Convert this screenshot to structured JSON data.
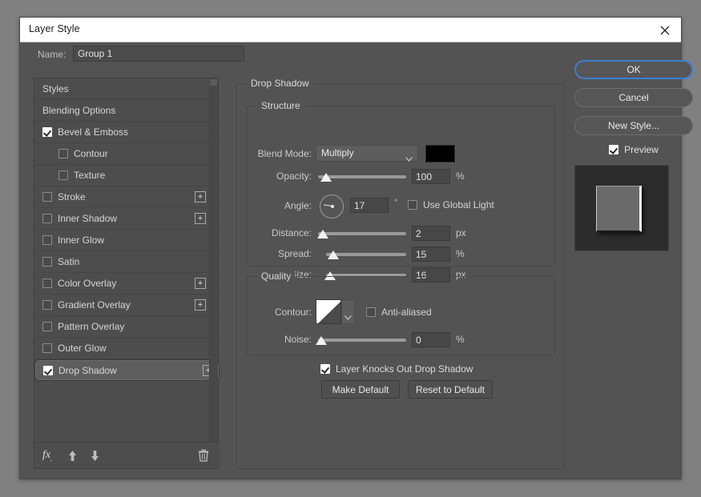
{
  "window": {
    "title": "Layer Style",
    "close_icon": "close-icon"
  },
  "name_field": {
    "label": "Name:",
    "value": "Group 1"
  },
  "styles_list": {
    "items": [
      {
        "label": "Styles",
        "type": "plain",
        "checkbox": null,
        "selected": false,
        "plus": false,
        "indent": false
      },
      {
        "label": "Blending Options",
        "type": "plain",
        "checkbox": null,
        "selected": false,
        "plus": false,
        "indent": false
      },
      {
        "label": "Bevel & Emboss",
        "type": "effect",
        "checkbox": true,
        "selected": false,
        "plus": false,
        "indent": false
      },
      {
        "label": "Contour",
        "type": "effect",
        "checkbox": false,
        "selected": false,
        "plus": false,
        "indent": true
      },
      {
        "label": "Texture",
        "type": "effect",
        "checkbox": false,
        "selected": false,
        "plus": false,
        "indent": true
      },
      {
        "label": "Stroke",
        "type": "effect",
        "checkbox": false,
        "selected": false,
        "plus": true,
        "indent": false
      },
      {
        "label": "Inner Shadow",
        "type": "effect",
        "checkbox": false,
        "selected": false,
        "plus": true,
        "indent": false
      },
      {
        "label": "Inner Glow",
        "type": "effect",
        "checkbox": false,
        "selected": false,
        "plus": false,
        "indent": false
      },
      {
        "label": "Satin",
        "type": "effect",
        "checkbox": false,
        "selected": false,
        "plus": false,
        "indent": false
      },
      {
        "label": "Color Overlay",
        "type": "effect",
        "checkbox": false,
        "selected": false,
        "plus": true,
        "indent": false
      },
      {
        "label": "Gradient Overlay",
        "type": "effect",
        "checkbox": false,
        "selected": false,
        "plus": true,
        "indent": false
      },
      {
        "label": "Pattern Overlay",
        "type": "effect",
        "checkbox": false,
        "selected": false,
        "plus": false,
        "indent": false
      },
      {
        "label": "Outer Glow",
        "type": "effect",
        "checkbox": false,
        "selected": false,
        "plus": false,
        "indent": false
      },
      {
        "label": "Drop Shadow",
        "type": "effect",
        "checkbox": true,
        "selected": true,
        "plus": true,
        "indent": false
      }
    ],
    "footer": {
      "fx_icon": "fx-icon",
      "up_icon": "arrow-up-icon",
      "down_icon": "arrow-down-icon",
      "trash_icon": "trash-icon"
    }
  },
  "settings": {
    "section_title": "Drop Shadow",
    "structure": {
      "legend": "Structure",
      "blend_mode_label": "Blend Mode:",
      "blend_mode_value": "Multiply",
      "shadow_color": "#000000",
      "opacity_label": "Opacity:",
      "opacity_value": "100",
      "opacity_unit": "%",
      "angle_label": "Angle:",
      "angle_value": "17",
      "angle_unit": "°",
      "use_global_light_label": "Use Global Light",
      "use_global_light_checked": false,
      "distance_label": "Distance:",
      "distance_value": "2",
      "distance_unit": "px",
      "spread_label": "Spread:",
      "spread_value": "15",
      "spread_unit": "%",
      "size_label": "Size:",
      "size_value": "16",
      "size_unit": "px"
    },
    "quality": {
      "legend": "Quality",
      "contour_label": "Contour:",
      "contour_preset": "Linear",
      "anti_aliased_label": "Anti-aliased",
      "anti_aliased_checked": false,
      "noise_label": "Noise:",
      "noise_value": "0",
      "noise_unit": "%"
    },
    "knockout_label": "Layer Knocks Out Drop Shadow",
    "knockout_checked": true,
    "make_default_label": "Make Default",
    "reset_default_label": "Reset to Default"
  },
  "actions": {
    "ok_label": "OK",
    "cancel_label": "Cancel",
    "new_style_label": "New Style...",
    "preview_label": "Preview",
    "preview_checked": true,
    "accent_color": "#3b7fd4"
  }
}
